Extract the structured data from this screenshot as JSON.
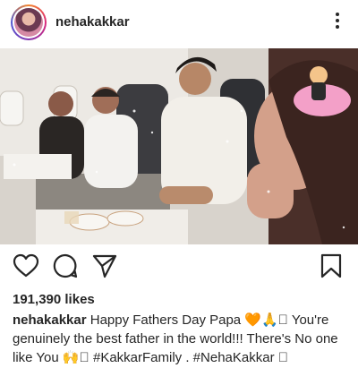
{
  "post": {
    "username": "nehakakkar",
    "likes": "191,390 likes",
    "caption": {
      "author": "nehakakkar",
      "text": " Happy Fathers Day Papa 🧡🙏\u0000 You're genuinely the best father in the world!!! There's No one like You 🙌\u0000 #KakkarFamily . #NehaKakkar \u0000"
    }
  },
  "icons": {
    "more": "more-options-icon",
    "like": "heart-icon",
    "comment": "comment-icon",
    "share": "send-icon",
    "save": "bookmark-icon"
  },
  "colors": {
    "text": "#262626",
    "background": "#ffffff"
  }
}
